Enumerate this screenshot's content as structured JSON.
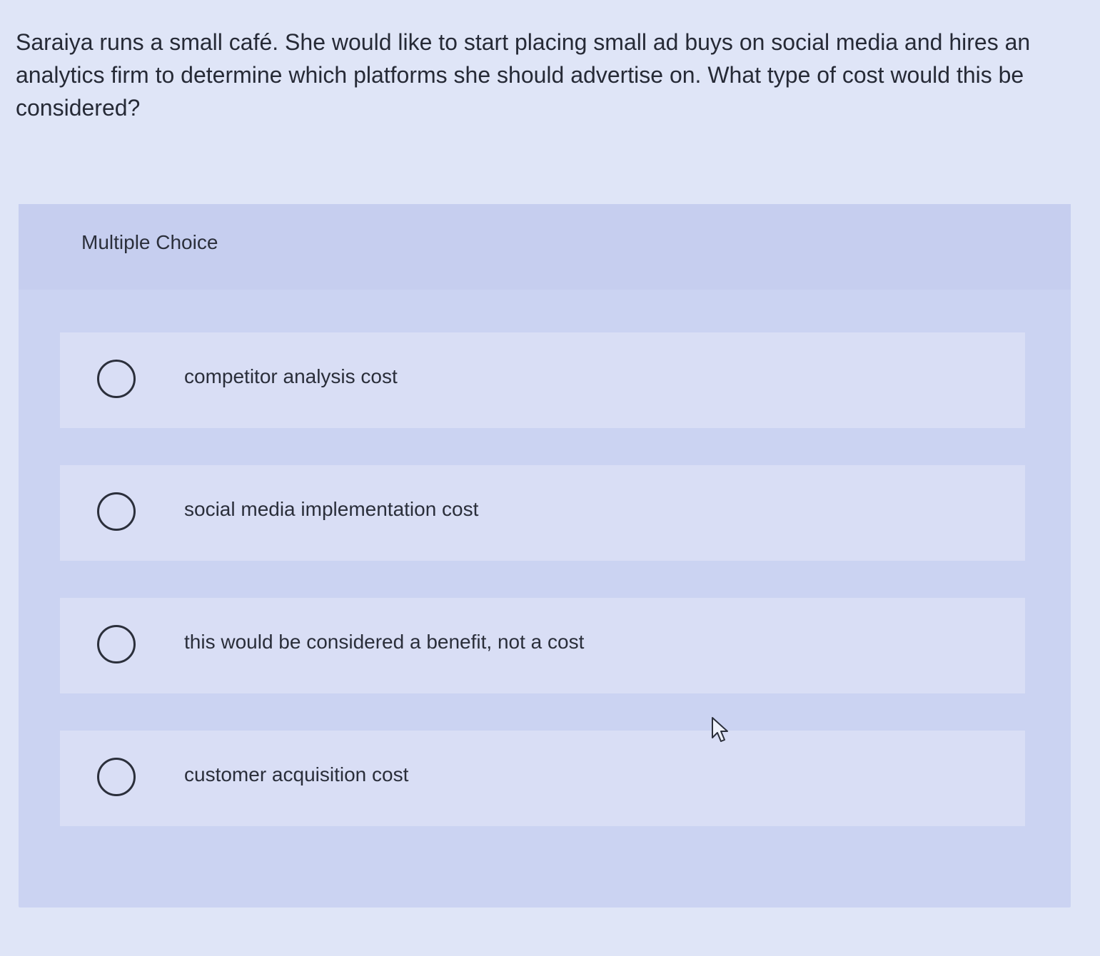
{
  "question": {
    "text": "Saraiya runs a small café. She would like to start placing small ad buys on social media and hires an analytics firm to determine which platforms she should advertise on. What type of cost would this be considered?"
  },
  "multiple_choice": {
    "label": "Multiple Choice",
    "options": [
      {
        "label": "competitor analysis cost",
        "selected": false
      },
      {
        "label": "social media implementation cost",
        "selected": false
      },
      {
        "label": "this would be considered a benefit, not a cost",
        "selected": false
      },
      {
        "label": "customer acquisition cost",
        "selected": false
      }
    ]
  },
  "icons": {
    "radio": "radio-button-icon",
    "cursor": "mouse-pointer-icon"
  },
  "colors": {
    "page_background": "#dfe5f7",
    "panel_background": "#cbd3f2",
    "option_background": "#d9def5",
    "text": "#2a2d3a"
  }
}
